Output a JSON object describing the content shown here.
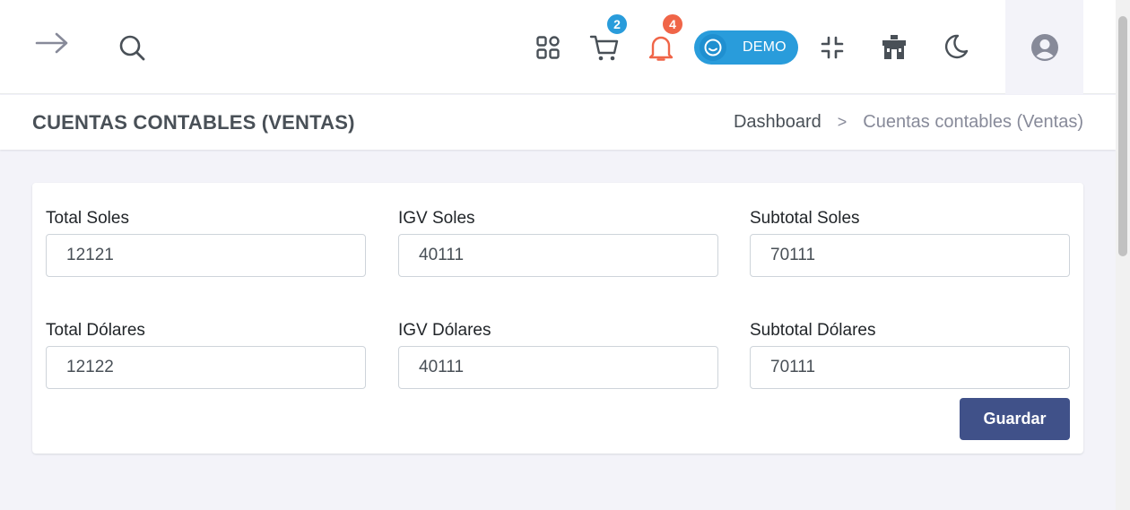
{
  "colors": {
    "primary_blue": "#299cdb",
    "danger_orange": "#f06548",
    "button_navy": "#405189",
    "icon_gray": "#495057",
    "muted": "#878a99"
  },
  "topbar": {
    "menu_toggle_icon": "arrow-right-icon",
    "search_icon": "search-icon",
    "apps_icon": "apps-grid-icon",
    "cart_icon": "cart-icon",
    "cart_count": "2",
    "notifications_icon": "bell-icon",
    "notifications_count": "4",
    "demo_label": "DEMO",
    "demo_icon": "smile-icon",
    "fullscreen_icon": "exit-fullscreen-icon",
    "store_icon": "store-icon",
    "theme_icon": "moon-icon",
    "user_icon": "user-avatar-icon"
  },
  "header": {
    "title": "CUENTAS CONTABLES (VENTAS)",
    "breadcrumb": {
      "home": "Dashboard",
      "separator": ">",
      "current": "Cuentas contables (Ventas)"
    }
  },
  "form": {
    "fields": [
      {
        "label": "Total Soles",
        "value": "12121"
      },
      {
        "label": "IGV Soles",
        "value": "40111"
      },
      {
        "label": "Subtotal Soles",
        "value": "70111"
      },
      {
        "label": "Total Dólares",
        "value": "12122"
      },
      {
        "label": "IGV Dólares",
        "value": "40111"
      },
      {
        "label": "Subtotal Dólares",
        "value": "70111"
      }
    ],
    "save_label": "Guardar"
  }
}
